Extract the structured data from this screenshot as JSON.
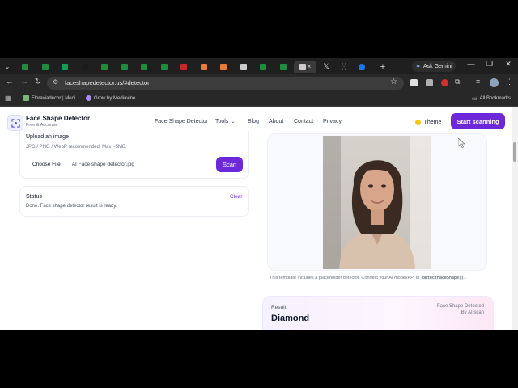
{
  "browser": {
    "tabs": [
      {
        "color": "#1e8e3e"
      },
      {
        "color": "#1e8e3e"
      },
      {
        "color": "#0f9d58"
      },
      {
        "color": "#1b1b1b"
      },
      {
        "color": "#1e8e3e"
      },
      {
        "color": "#1e8e3e"
      },
      {
        "color": "#1e8e3e"
      },
      {
        "color": "#1e8e3e"
      },
      {
        "color": "#c62828"
      },
      {
        "color": "#e67c3a"
      },
      {
        "color": "#e67c3a"
      },
      {
        "color": "#cccccc"
      },
      {
        "color": "#1e8e3e"
      },
      {
        "color": "#1e8e3e"
      },
      {
        "color": "#cccccc"
      }
    ],
    "x_tab_glyph": "𝕏",
    "ask_gemini": "Ask Gemini",
    "url": "faceshapedetector.us/#detector",
    "bookmarks": [
      {
        "label": "Floraviadecor | Medi..."
      },
      {
        "label": "Grow by Mediavine"
      }
    ],
    "all_bookmarks": "All Bookmarks"
  },
  "site": {
    "brand": "Face Shape Detector",
    "tagline": "Free & Accurate",
    "nav": {
      "detector": "Face Shape Detector",
      "tools": "Tools",
      "blog": "Blog",
      "about": "About",
      "contact": "Contact",
      "privacy": "Privacy"
    },
    "theme": "Theme",
    "start": "Start scanning"
  },
  "upload": {
    "title": "Upload an image",
    "hint": "JPG / PNG / WebP recommended. Max ~5MB.",
    "choose": "Choose File",
    "filename": "AI Face shape detector.jpg",
    "scan": "Scan"
  },
  "status": {
    "title": "Status",
    "clear": "Clear",
    "message": "Done. Face shape detector result is ready."
  },
  "preview": {
    "caption": "This template includes a placeholder detector. Connect your AI model/API in",
    "caption_code": "detectFaceShape()",
    "caption_end": "."
  },
  "result": {
    "label": "Result",
    "shape": "Diamond",
    "detected": "Face Shape Detected",
    "by": "By AI scan"
  }
}
